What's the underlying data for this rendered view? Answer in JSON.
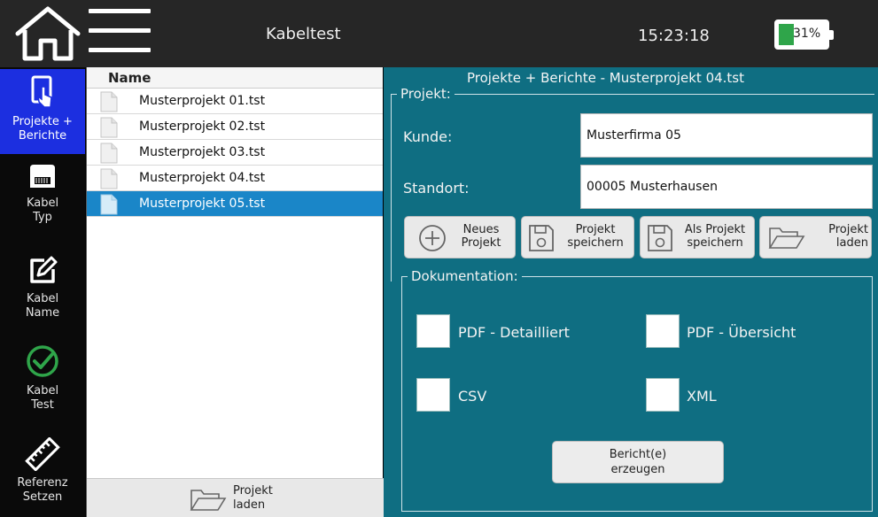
{
  "header": {
    "title": "Kabeltest",
    "time": "15:23:18",
    "battery": {
      "percent_label": "31%",
      "level": 0.31,
      "fill_color": "#2fa54a"
    }
  },
  "sidebar": {
    "items": [
      {
        "label_line1": "Projekte +",
        "label_line2": "Berichte",
        "icon": "document-touch-icon",
        "active": true
      },
      {
        "label_line1": "Kabel",
        "label_line2": "Typ",
        "icon": "ethernet-port-icon",
        "active": false
      },
      {
        "label_line1": "Kabel",
        "label_line2": "Name",
        "icon": "edit-icon",
        "active": false
      },
      {
        "label_line1": "Kabel",
        "label_line2": "Test",
        "icon": "check-circle-icon",
        "active": false
      },
      {
        "label_line1": "Referenz",
        "label_line2": "Setzen",
        "icon": "ruler-icon",
        "active": false
      }
    ],
    "active_color": "#1c2fe0"
  },
  "file_list": {
    "header": "Name",
    "files": [
      {
        "name": "Musterprojekt 01.tst",
        "selected": false
      },
      {
        "name": "Musterprojekt 02.tst",
        "selected": false
      },
      {
        "name": "Musterprojekt 03.tst",
        "selected": false
      },
      {
        "name": "Musterprojekt 04.tst",
        "selected": false
      },
      {
        "name": "Musterprojekt 05.tst",
        "selected": true
      }
    ],
    "footer_button": {
      "line1": "Projekt",
      "line2": "laden",
      "icon": "folder-open-icon"
    }
  },
  "panel": {
    "title": "Projekte + Berichte - Musterprojekt 04.tst",
    "projekt_group_label": "Projekt:",
    "kunde_label": "Kunde:",
    "kunde_value": "Musterfirma 05",
    "standort_label": "Standort:",
    "standort_value": "00005 Musterhausen",
    "buttons": [
      {
        "line1": "Neues",
        "line2": "Projekt",
        "icon": "plus-circle-icon"
      },
      {
        "line1": "Projekt",
        "line2": "speichern",
        "icon": "floppy-disk-icon"
      },
      {
        "line1": "Als Projekt",
        "line2": "speichern",
        "icon": "floppy-disk-icon"
      },
      {
        "line1": "Projekt",
        "line2": "laden",
        "icon": "folder-open-icon"
      }
    ],
    "doku_group_label": "Dokumentation:",
    "options": [
      {
        "label": "PDF - Detailliert",
        "checked": false
      },
      {
        "label": "PDF - Übersicht",
        "checked": false
      },
      {
        "label": "CSV",
        "checked": false
      },
      {
        "label": "XML",
        "checked": false
      }
    ],
    "generate_button": {
      "line1": "Bericht(e)",
      "line2": "erzeugen"
    },
    "background_color": "#0f6e82"
  }
}
